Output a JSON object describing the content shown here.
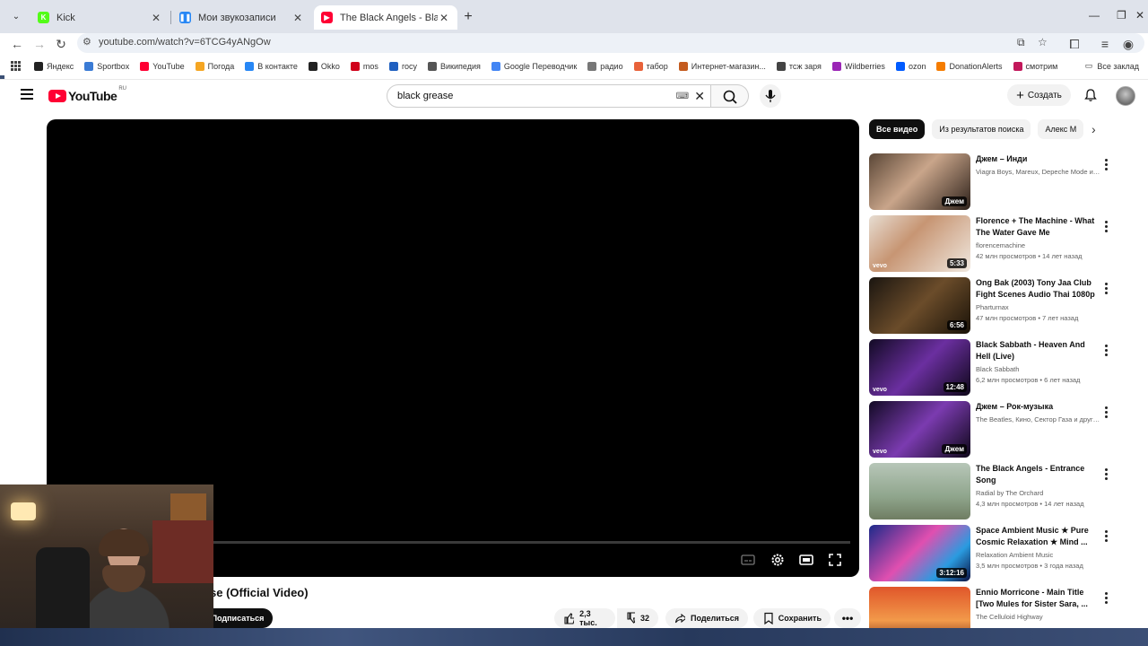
{
  "browser": {
    "tabs": [
      {
        "title": "Kick",
        "favicon_color": "#53fc18",
        "active": false
      },
      {
        "title": "Мои звукозаписи",
        "favicon_color": "#2787f5",
        "active": false
      },
      {
        "title": "The Black Angels - Black Grease",
        "favicon_color": "#ff0033",
        "active": true
      }
    ],
    "url": "youtube.com/watch?v=6TCG4yANgOw",
    "bookmarks": [
      {
        "label": "Яндекс",
        "color": "#222222"
      },
      {
        "label": "Sportbox",
        "color": "#3a7bd5"
      },
      {
        "label": "YouTube",
        "color": "#ff0033"
      },
      {
        "label": "Погода",
        "color": "#f5a623"
      },
      {
        "label": "В контакте",
        "color": "#2787f5"
      },
      {
        "label": "Okko",
        "color": "#222222"
      },
      {
        "label": "mos",
        "color": "#d0021b"
      },
      {
        "label": "госу",
        "color": "#2060c0"
      },
      {
        "label": "Википедия",
        "color": "#555555"
      },
      {
        "label": "Google Переводчик",
        "color": "#4285f4"
      },
      {
        "label": "радио",
        "color": "#777777"
      },
      {
        "label": "табор",
        "color": "#e8623a"
      },
      {
        "label": "Интернет-магазин...",
        "color": "#c45b1e"
      },
      {
        "label": "тсж заря",
        "color": "#444444"
      },
      {
        "label": "Wildberries",
        "color": "#9b26b6"
      },
      {
        "label": "ozon",
        "color": "#005bff"
      },
      {
        "label": "DonationAlerts",
        "color": "#f57c00"
      },
      {
        "label": "смотрим",
        "color": "#c2185b"
      }
    ],
    "bookmarks_folder": "Все заклад"
  },
  "youtube": {
    "logo_text": "YouTube",
    "country_code": "RU",
    "search_query": "black grease",
    "create_label": "Создать",
    "video_title": "se (Official Video)",
    "subscribe_label": "Подписаться",
    "likes": "2,3 тыс.",
    "dislikes": "32",
    "share_label": "Поделиться",
    "save_label": "Сохранить",
    "chips": [
      "Все видео",
      "Из результатов поиска",
      "Алекс М"
    ],
    "recommendations": [
      {
        "title": "Джем – Инди",
        "channel": "Viagra Boys, Mareux, Depeche Mode и д...",
        "meta": "",
        "badge": "Джем",
        "vevo": false,
        "thumb": "linear-gradient(135deg,#5a4636,#c9a58a 45%,#2d211a)"
      },
      {
        "title": "Florence + The Machine - What The Water Gave Me",
        "channel": "florencemachine",
        "meta": "42 млн просмотров • 14 лет назад",
        "badge": "5:33",
        "vevo": true,
        "thumb": "linear-gradient(135deg,#e7ddd2,#c79573 40%,#f0e8df)"
      },
      {
        "title": "Ong Bak (2003) Tony Jaa Club Fight Scenes Audio Thai 1080p",
        "channel": "Pharturnax",
        "meta": "47 млн просмотров • 7 лет назад",
        "badge": "6:56",
        "vevo": false,
        "thumb": "linear-gradient(135deg,#1a1510,#6b4c2a 50%,#191208)"
      },
      {
        "title": "Black Sabbath - Heaven And Hell (Live)",
        "channel": "Black Sabbath",
        "meta": "6,2 млн просмотров • 6 лет назад",
        "badge": "12:48",
        "vevo": true,
        "thumb": "linear-gradient(135deg,#120a24,#6b2fa0 50%,#0d0718)"
      },
      {
        "title": "Джем – Рок-музыка",
        "channel": "The Beatles, Кино, Сектор Газа и други...",
        "meta": "",
        "badge": "Джем",
        "vevo": true,
        "thumb": "linear-gradient(135deg,#120a24,#7b3bb0 50%,#0d0718)"
      },
      {
        "title": "The Black Angels - Entrance Song",
        "channel": "Radial by The Orchard",
        "meta": "4,3 млн просмотров • 14 лет назад",
        "badge": "",
        "vevo": false,
        "thumb": "linear-gradient(180deg,#b7c6b8,#8fa58c 60%,#6f7d62)"
      },
      {
        "title": "Space Ambient Music ★ Pure Cosmic Relaxation ★ Mind ...",
        "channel": "Relaxation Ambient Music",
        "meta": "3,5 млн просмотров • 3 года назад",
        "badge": "3:12:16",
        "vevo": false,
        "thumb": "linear-gradient(135deg,#1b2a8a,#e04fb0 45%,#2a9be0 75%,#0b1040)"
      },
      {
        "title": "Ennio Morricone - Main Title [Two Mules for Sister Sara, ...",
        "channel": "The Celluloid Highway",
        "meta": "",
        "badge": "",
        "vevo": false,
        "thumb": "linear-gradient(180deg,#e0562a,#f29a4a 60%,#803018)"
      }
    ]
  }
}
